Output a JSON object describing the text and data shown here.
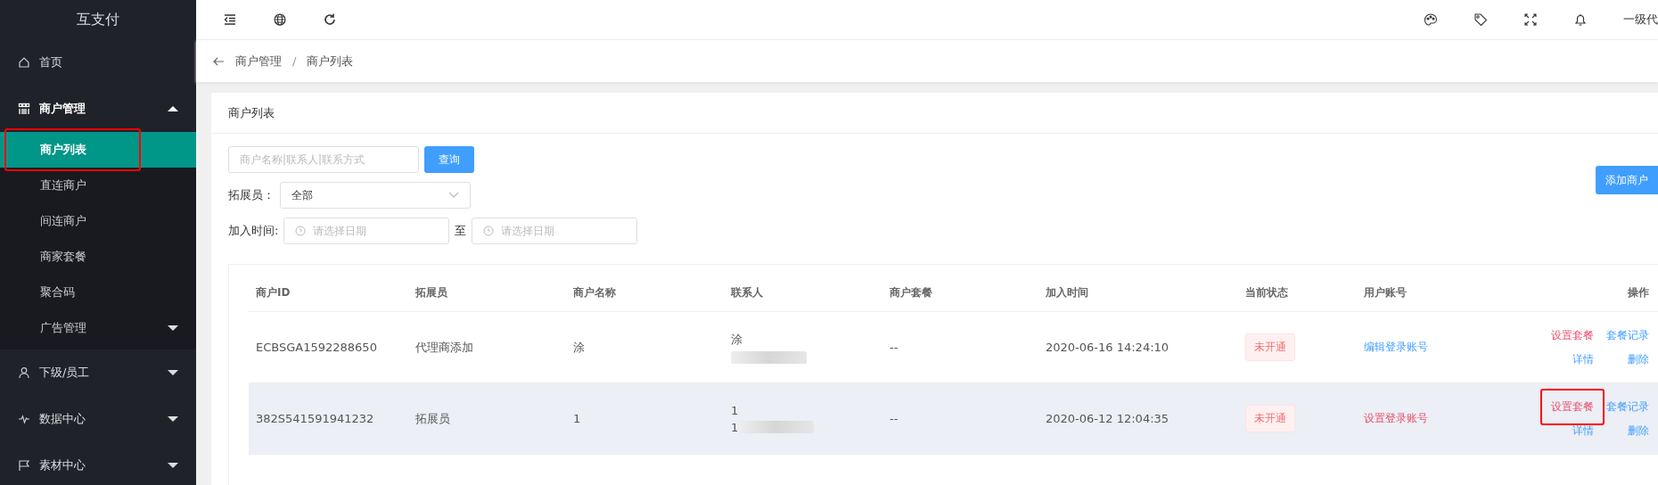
{
  "sidebar": {
    "logo": "互支付",
    "items": [
      {
        "label": "首页",
        "expanded": false,
        "has_children": false
      },
      {
        "label": "商户管理",
        "expanded": true,
        "has_children": true,
        "children": [
          {
            "label": "商户列表",
            "selected": true,
            "highlighted": true,
            "has_children": false
          },
          {
            "label": "直连商户",
            "selected": false,
            "highlighted": false,
            "has_children": false
          },
          {
            "label": "间连商户",
            "selected": false,
            "highlighted": false,
            "has_children": false
          },
          {
            "label": "商家套餐",
            "selected": false,
            "highlighted": false,
            "has_children": false
          },
          {
            "label": "聚合码",
            "selected": false,
            "highlighted": false,
            "has_children": false
          },
          {
            "label": "广告管理",
            "selected": false,
            "highlighted": false,
            "has_children": true
          }
        ]
      },
      {
        "label": "下级/员工",
        "expanded": false,
        "has_children": true
      },
      {
        "label": "数据中心",
        "expanded": false,
        "has_children": true
      },
      {
        "label": "素材中心",
        "expanded": false,
        "has_children": true
      }
    ]
  },
  "topbar": {
    "user": "一级代"
  },
  "breadcrumb": {
    "items": [
      "商户管理",
      "商户列表"
    ],
    "separator": "/"
  },
  "card": {
    "title": "商户列表",
    "search": {
      "placeholder": "商户名称|联系人|联系方式",
      "button": "查询"
    },
    "add_button": "添加商户",
    "promoter": {
      "label": "拓展员：",
      "value": "全部"
    },
    "join_time": {
      "label": "加入时间:",
      "from_placeholder": "请选择日期",
      "separator": "至",
      "to_placeholder": "请选择日期"
    }
  },
  "table": {
    "columns": [
      "商户ID",
      "拓展员",
      "商户名称",
      "联系人",
      "商户套餐",
      "加入时间",
      "当前状态",
      "用户账号",
      "操作"
    ],
    "rows": [
      {
        "id": "ECBSGA1592288650",
        "promoter": "代理商添加",
        "name": "涂",
        "contact": [
          "涂"
        ],
        "contact_blurred": true,
        "package": "--",
        "joined": "2020-06-16 14:24:10",
        "status": "未开通",
        "account": {
          "label": "编辑登录账号",
          "kind": "primary"
        },
        "hovered": false,
        "actions": [
          {
            "label": "设置套餐",
            "kind": "danger",
            "highlighted": false
          },
          {
            "label": "套餐记录",
            "kind": "primary",
            "highlighted": false
          },
          {
            "label": "详情",
            "kind": "primary",
            "highlighted": false
          },
          {
            "label": "删除",
            "kind": "primary",
            "highlighted": false
          }
        ]
      },
      {
        "id": "382S541591941232",
        "promoter": "拓展员",
        "name": "1",
        "contact": [
          "1",
          "1"
        ],
        "contact_blurred": true,
        "package": "--",
        "joined": "2020-06-12 12:04:35",
        "status": "未开通",
        "account": {
          "label": "设置登录账号",
          "kind": "danger"
        },
        "hovered": true,
        "actions": [
          {
            "label": "设置套餐",
            "kind": "danger",
            "highlighted": true
          },
          {
            "label": "套餐记录",
            "kind": "primary",
            "highlighted": false
          },
          {
            "label": "详情",
            "kind": "primary",
            "highlighted": false
          },
          {
            "label": "删除",
            "kind": "primary",
            "highlighted": false
          }
        ]
      }
    ]
  }
}
